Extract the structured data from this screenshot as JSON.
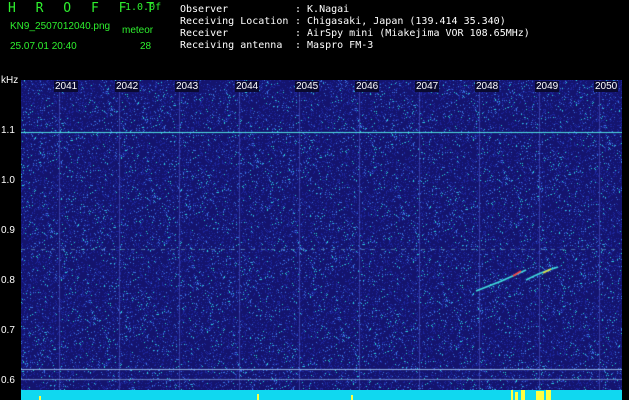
{
  "header": {
    "app_title": "H R O F F T",
    "version": "1.0.0f",
    "filename": "KN9_2507012040.png",
    "mode_label": "meteor",
    "datetime": "25.07.01 20:40",
    "count": "28",
    "info_labels": [
      "Observer",
      "Receiving Location",
      "Receiver",
      "Receiving antenna"
    ],
    "info_values": [
      ": K.Nagai",
      ": Chigasaki, Japan (139.414 35.340)",
      ": AirSpy mini (Miakejima VOR 108.65MHz)",
      ": Maspro FM-3"
    ]
  },
  "spectrogram": {
    "unit_label": "kHz",
    "y_ticks": [
      "1.1",
      "1.0",
      "0.9",
      "0.8",
      "0.7",
      "0.6"
    ],
    "x_ticks": [
      "2041",
      "2042",
      "2043",
      "2044",
      "2045",
      "2046",
      "2047",
      "2048",
      "2049",
      "2050"
    ],
    "colors": {
      "background": "#1a1a78",
      "carrier": "#50e0e0",
      "signal_bar": "#10d8f0",
      "burst": "#ffff40"
    }
  }
}
